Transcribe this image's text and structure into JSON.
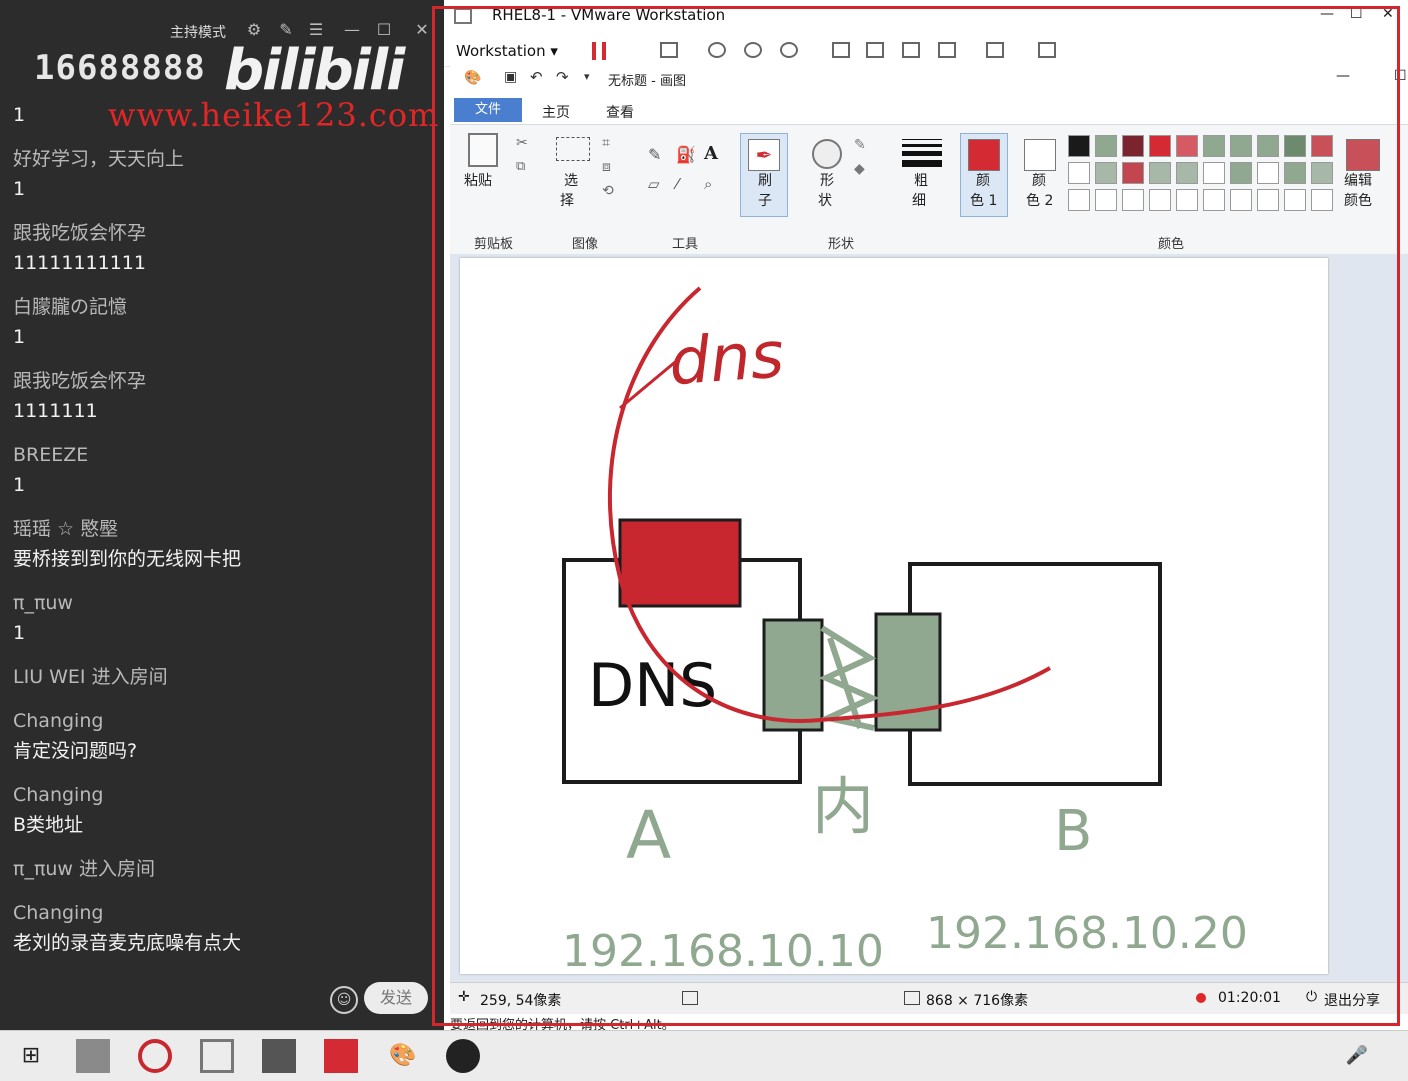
{
  "chat": {
    "room_id": "16688888",
    "host_mode": "主持模式",
    "logo": "bilibili",
    "watermark": "www.heike123.com",
    "messages": [
      {
        "user": "",
        "text": "1"
      },
      {
        "user": "好好学习，天天向上",
        "text": "1"
      },
      {
        "user": "跟我吃饭会怀孕",
        "text": "11111111111"
      },
      {
        "user": "白朦朧の記憶",
        "text": "1"
      },
      {
        "user": "跟我吃饭会怀孕",
        "text": "1111111"
      },
      {
        "user": "BREEZE",
        "text": "1"
      },
      {
        "user": "瑶瑶 ☆ 愍壂",
        "text": "要桥接到到你的无线网卡把"
      },
      {
        "user": "π_πuw",
        "text": "1"
      },
      {
        "user": "LIU WEI 进入房间",
        "text": ""
      },
      {
        "user": "Changing",
        "text": "肯定没问题吗?"
      },
      {
        "user": "Changing",
        "text": "B类地址"
      },
      {
        "user": "π_πuw 进入房间",
        "text": ""
      },
      {
        "user": "Changing",
        "text": "老刘的录音麦克底噪有点大"
      }
    ],
    "send_label": "发送"
  },
  "vmware": {
    "title": "RHEL8-1 - VMware Workstation",
    "menu": "Workstation ▾"
  },
  "paint": {
    "title": "无标题 - 画图",
    "tabs": {
      "file": "文件",
      "home": "主页",
      "view": "查看"
    },
    "groups": {
      "clipboard": "剪贴板",
      "image": "图像",
      "tools": "工具",
      "shapes": "形状",
      "colors": "颜色"
    },
    "buttons": {
      "paste": "粘贴",
      "select1": "选",
      "select2": "择",
      "brush1": "刷",
      "brush2": "子",
      "shape1": "形",
      "shape2": "状",
      "size1": "粗",
      "size2": "细",
      "color1a": "颜",
      "color1b": "色 1",
      "color2a": "颜",
      "color2b": "色 2",
      "edit1": "编辑",
      "edit2": "颜色"
    },
    "colors": {
      "color1": "#d42a33",
      "color2": "#ffffff"
    },
    "palette": [
      "#1a1a1a",
      "#8fa88f",
      "#7a2430",
      "#d42a33",
      "#d65a63",
      "#8fa88f",
      "#8fa88f",
      "#8fa88f",
      "#6e8a6e",
      "#c85059"
    ],
    "palette_row2": [
      "#ffffff",
      "#a8b8a8",
      "#c24550",
      "#a8b8a8",
      "#a8b8a8",
      "#ffffff",
      "#8fa88f",
      "#ffffff",
      "#8fa88f",
      "#a8b8a8"
    ],
    "canvas_text": {
      "dns_top": "dns",
      "dns_box": "DNS",
      "label_a": "A",
      "label_b": "B",
      "label_nei": "内",
      "ip_a": "192.168.10.10",
      "ip_b": "192.168.10.20"
    },
    "status": {
      "cursor_pos": "259, 54像素",
      "canvas_size": "868 × 716像素",
      "rec_time": "01:20:01",
      "exit_share": "退出分享"
    },
    "vm_hint": "要返回到您的计算机，请按 Ctrl+Alt。"
  }
}
